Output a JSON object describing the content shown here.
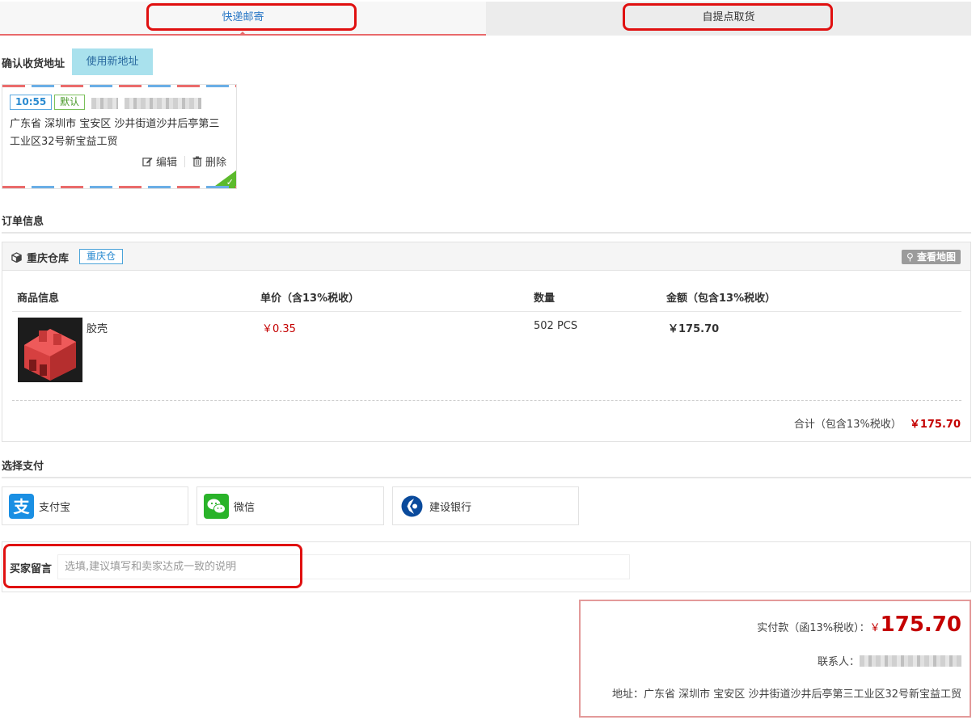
{
  "tabs": {
    "express": "快递邮寄",
    "pickup": "自提点取货"
  },
  "address": {
    "section_title": "确认收货地址",
    "new_address_button": "使用新地址",
    "card": {
      "time_tag": "10:55",
      "default_tag": "默认",
      "text": "广东省 深圳市 宝安区 沙井街道沙井后亭第三工业区32号新宝益工贸",
      "edit": "编辑",
      "delete": "删除"
    }
  },
  "order": {
    "section_title": "订单信息",
    "warehouse": {
      "name": "重庆仓库",
      "badge": "重庆仓",
      "map_button": "查看地图"
    },
    "columns": {
      "product": "商品信息",
      "unit_price": "单价（含13%税收）",
      "quantity": "数量",
      "amount": "金额（包含13%税收）"
    },
    "item": {
      "name": "胶壳",
      "unit_price": "￥0.35",
      "quantity": "502 PCS",
      "amount": "￥175.70"
    },
    "subtotal_label": "合计（包含13%税收）",
    "subtotal_amount": "￥175.70"
  },
  "payment": {
    "section_title": "选择支付",
    "options": [
      {
        "label": "支付宝",
        "icon": "alipay-icon",
        "color": "#1a8fe3"
      },
      {
        "label": "微信",
        "icon": "wechat-icon",
        "color": "#2ab32a"
      },
      {
        "label": "建设银行",
        "icon": "ccb-icon",
        "color": "#0a4a9c"
      }
    ]
  },
  "message": {
    "label": "买家留言",
    "placeholder": "选填,建议填写和卖家达成一致的说明"
  },
  "summary": {
    "paid_label": "实付款（函13%税收）：",
    "currency": "￥",
    "paid_amount": "175.70",
    "contact_label": "联系人：",
    "address_label": "地址：",
    "address_text": "广东省 深圳市 宝安区 沙井街道沙井后亭第三工业区32号新宝益工贸"
  },
  "colors": {
    "accent_red": "#c40000",
    "tab_underline": "#e8696b",
    "highlight_box": "#e01010"
  }
}
